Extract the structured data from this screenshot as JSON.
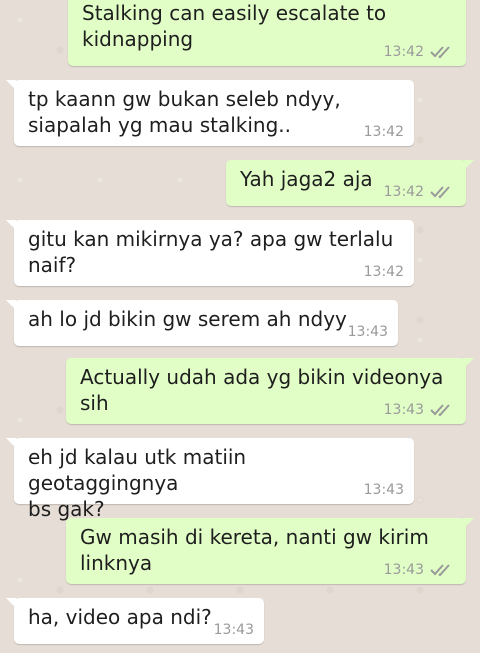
{
  "messages": [
    {
      "direction": "out",
      "text": "Stalking can easily escalate to\nkidnapping",
      "time": "13:42",
      "status_icon": "double-check-icon"
    },
    {
      "direction": "in",
      "text": "tp kaann gw bukan seleb ndyy,\nsiapalah yg mau stalking..",
      "time": "13:42"
    },
    {
      "direction": "out",
      "text": "Yah jaga2 aja",
      "time": "13:42",
      "status_icon": "double-check-icon"
    },
    {
      "direction": "in",
      "text": "gitu kan mikirnya ya? apa gw terlalu\nnaif?",
      "time": "13:42"
    },
    {
      "direction": "in",
      "text": "ah lo jd bikin gw serem ah ndyy",
      "time": "13:43"
    },
    {
      "direction": "out",
      "text": "Actually udah ada yg bikin videonya\nsih",
      "time": "13:43",
      "status_icon": "double-check-icon"
    },
    {
      "direction": "in",
      "text": "eh jd kalau utk matiin geotaggingnya\nbs gak?",
      "time": "13:43"
    },
    {
      "direction": "out",
      "text": "Gw masih di kereta, nanti gw kirim\nlinknya",
      "time": "13:43",
      "status_icon": "double-check-icon"
    },
    {
      "direction": "in",
      "text": "ha, video apa ndi?",
      "time": "13:43"
    }
  ],
  "colors": {
    "outgoing_bubble": "#e1fec6",
    "incoming_bubble": "#ffffff",
    "wallpaper": "#e6ded6",
    "time_text": "#9a9a9a",
    "tick": "#9a9a9a"
  }
}
